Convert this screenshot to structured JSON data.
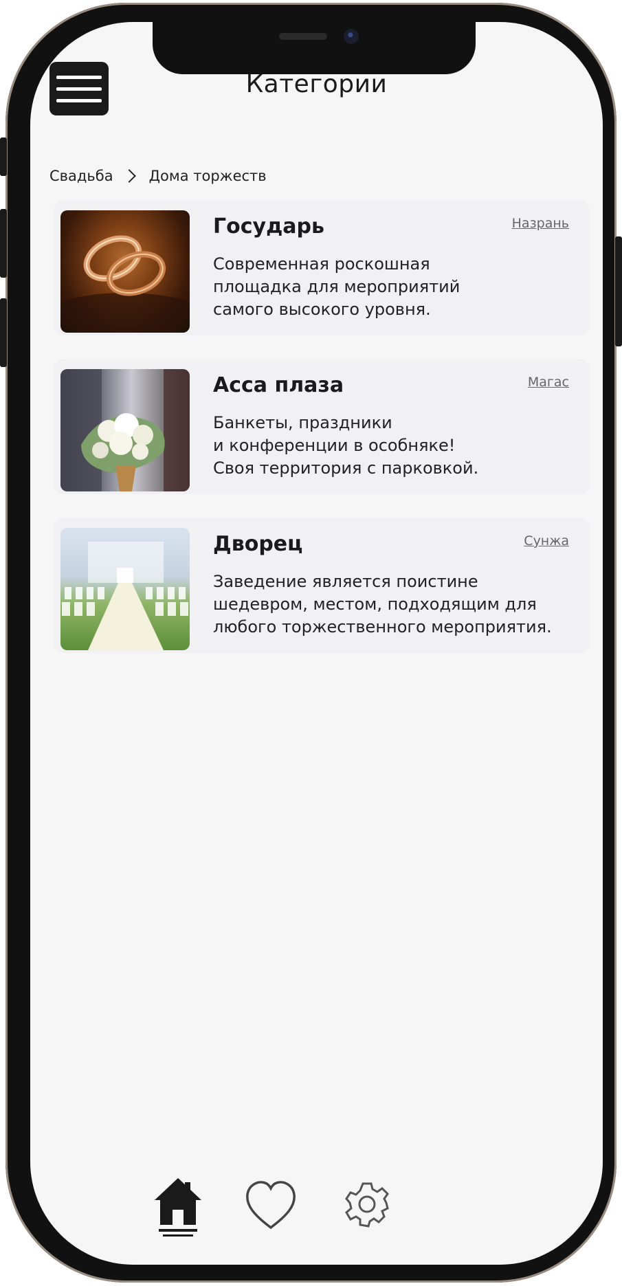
{
  "header": {
    "title": "Категории",
    "menu_icon": "hamburger-menu-icon"
  },
  "breadcrumb": {
    "items": [
      "Свадьба",
      "Дома торжеств"
    ],
    "separator_icon": "chevron-right-icon"
  },
  "venues": [
    {
      "name": "Государь",
      "city": "Назрань",
      "description_lines": [
        "Современная роскошная",
        "площадка для мероприятий",
        "самого высокого уровня."
      ],
      "image": "wedding-rings-image"
    },
    {
      "name": "Асса плаза",
      "city": "Магас",
      "description_lines": [
        "Банкеты, праздники",
        "и конференции в особняке!",
        "Своя территория с парковкой."
      ],
      "image": "bridal-bouquet-image"
    },
    {
      "name": "Дворец",
      "city": "Сунжа",
      "description_lines": [
        "Заведение является поистине",
        "шедевром, местом, подходящим для",
        "любого торжественного мероприятия."
      ],
      "image": "wedding-aisle-image"
    }
  ],
  "bottom_nav": {
    "items": [
      {
        "icon": "home-icon",
        "active": true
      },
      {
        "icon": "heart-icon",
        "active": false
      },
      {
        "icon": "gear-icon",
        "active": false
      }
    ]
  },
  "colors": {
    "background": "#f6f6f7",
    "card": "#f1f1f4",
    "text": "#1a1a1a",
    "city_link": "#666666",
    "phone_frame": "#111111"
  }
}
